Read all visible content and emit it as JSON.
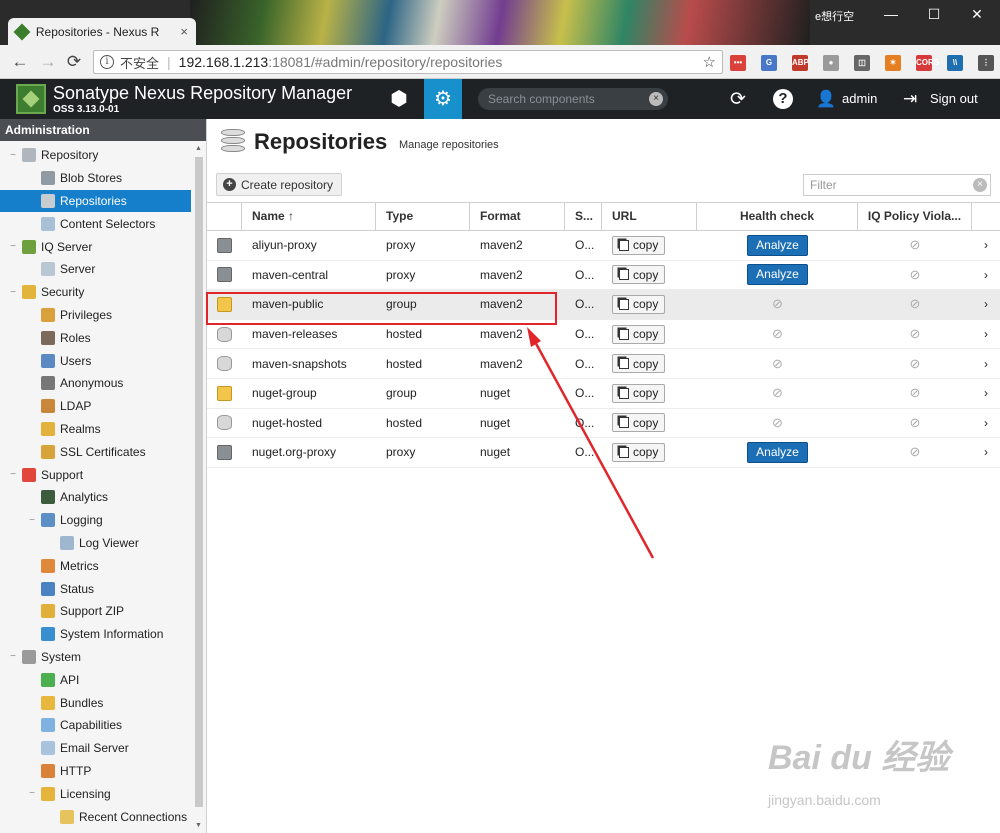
{
  "browser": {
    "tab_title": "Repositories - Nexus R",
    "tab_close": "×",
    "window_user": "e想行空",
    "window_buttons": [
      "—",
      "☐",
      "✕"
    ],
    "nav": {
      "back": "←",
      "forward": "→",
      "reload": "⟳"
    },
    "info_icon": "i",
    "insecure_label": "不安全",
    "separator": "|",
    "url_host": "192.168.1.213",
    "url_path": ":18081/#admin/repository/repositories",
    "bookmark_star": "☆",
    "extensions": [
      {
        "name": "ext-dots",
        "color": "#d9413a",
        "label": "•••"
      },
      {
        "name": "ext-translate",
        "color": "#4a78c8",
        "label": "G"
      },
      {
        "name": "ext-abp",
        "color": "#c0392b",
        "label": "ABP"
      },
      {
        "name": "ext-record",
        "color": "#9a9a9a",
        "label": "●"
      },
      {
        "name": "ext-reader",
        "color": "#666666",
        "label": "◫"
      },
      {
        "name": "ext-orange",
        "color": "#e67e22",
        "label": "✶"
      },
      {
        "name": "ext-cors",
        "color": "#d63a3a",
        "label": "CORS"
      },
      {
        "name": "ext-stripes",
        "color": "#1f6fb0",
        "label": "\\\\"
      },
      {
        "name": "ext-menu",
        "color": "#555555",
        "label": "⋮"
      }
    ]
  },
  "header": {
    "title": "Sonatype Nexus Repository Manager",
    "version": "OSS 3.13.0-01",
    "browse_icon": "⬢",
    "admin_icon": "⚙",
    "search_placeholder": "Search components",
    "search_clear": "×",
    "refresh_icon": "⟳",
    "help_icon": "?",
    "user_icon": "👤",
    "user": "admin",
    "signout_icon": "⇥",
    "signout": "Sign out"
  },
  "sidebar": {
    "title": "Administration",
    "items": [
      {
        "label": "Repository",
        "level": 0,
        "toggle": "−",
        "color": "#b0b6bd"
      },
      {
        "label": "Blob Stores",
        "level": 1,
        "toggle": "",
        "color": "#8f9aa3"
      },
      {
        "label": "Repositories",
        "level": 1,
        "toggle": "",
        "color": "#c7ccd1",
        "selected": true
      },
      {
        "label": "Content Selectors",
        "level": 1,
        "toggle": "",
        "color": "#a8c0d8"
      },
      {
        "label": "IQ Server",
        "level": 0,
        "toggle": "−",
        "color": "#6fa03e"
      },
      {
        "label": "Server",
        "level": 1,
        "toggle": "",
        "color": "#b9c7d4"
      },
      {
        "label": "Security",
        "level": 0,
        "toggle": "−",
        "color": "#e2b43b"
      },
      {
        "label": "Privileges",
        "level": 1,
        "toggle": "",
        "color": "#d9a03b"
      },
      {
        "label": "Roles",
        "level": 1,
        "toggle": "",
        "color": "#7b6a5a"
      },
      {
        "label": "Users",
        "level": 1,
        "toggle": "",
        "color": "#5b89c4"
      },
      {
        "label": "Anonymous",
        "level": 1,
        "toggle": "",
        "color": "#777777"
      },
      {
        "label": "LDAP",
        "level": 1,
        "toggle": "",
        "color": "#c9873a"
      },
      {
        "label": "Realms",
        "level": 1,
        "toggle": "",
        "color": "#e3b23c"
      },
      {
        "label": "SSL Certificates",
        "level": 1,
        "toggle": "",
        "color": "#d6a43b"
      },
      {
        "label": "Support",
        "level": 0,
        "toggle": "−",
        "color": "#e2453c"
      },
      {
        "label": "Analytics",
        "level": 1,
        "toggle": "",
        "color": "#3d5b3d"
      },
      {
        "label": "Logging",
        "level": 1,
        "toggle": "−",
        "color": "#5d8fc7"
      },
      {
        "label": "Log Viewer",
        "level": 2,
        "toggle": "",
        "color": "#9fb6cf"
      },
      {
        "label": "Metrics",
        "level": 1,
        "toggle": "",
        "color": "#e0893a"
      },
      {
        "label": "Status",
        "level": 1,
        "toggle": "",
        "color": "#4b82c2"
      },
      {
        "label": "Support ZIP",
        "level": 1,
        "toggle": "",
        "color": "#e0b03a"
      },
      {
        "label": "System Information",
        "level": 1,
        "toggle": "",
        "color": "#3a8fd0"
      },
      {
        "label": "System",
        "level": 0,
        "toggle": "−",
        "color": "#9a9a9a"
      },
      {
        "label": "API",
        "level": 1,
        "toggle": "",
        "color": "#4caf50"
      },
      {
        "label": "Bundles",
        "level": 1,
        "toggle": "",
        "color": "#e8b83e"
      },
      {
        "label": "Capabilities",
        "level": 1,
        "toggle": "",
        "color": "#7fb2e0"
      },
      {
        "label": "Email Server",
        "level": 1,
        "toggle": "",
        "color": "#a9c3de"
      },
      {
        "label": "HTTP",
        "level": 1,
        "toggle": "",
        "color": "#d9823a"
      },
      {
        "label": "Licensing",
        "level": 1,
        "toggle": "−",
        "color": "#e6b33c"
      },
      {
        "label": "Recent Connections",
        "level": 2,
        "toggle": "",
        "color": "#e6c35c"
      }
    ],
    "scroll_up": "▲",
    "scroll_down": "▼"
  },
  "main": {
    "title": "Repositories",
    "subtitle": "Manage repositories",
    "create_button": "Create repository",
    "create_icon": "+",
    "filter_placeholder": "Filter",
    "filter_clear": "×",
    "columns": [
      "Name ↑",
      "Type",
      "Format",
      "S...",
      "URL",
      "Health check",
      "IQ Policy Viola..."
    ],
    "copy_label": "copy",
    "analyze_label": "Analyze",
    "na_symbol": "⊘",
    "row_chevron": "›",
    "rows": [
      {
        "name": "aliyun-proxy",
        "type": "proxy",
        "format": "maven2",
        "status": "O...",
        "health": "analyze",
        "iq": "⊘"
      },
      {
        "name": "maven-central",
        "type": "proxy",
        "format": "maven2",
        "status": "O...",
        "health": "analyze",
        "iq": "⊘"
      },
      {
        "name": "maven-public",
        "type": "group",
        "format": "maven2",
        "status": "O...",
        "health": "⊘",
        "iq": "⊘",
        "highlighted": true
      },
      {
        "name": "maven-releases",
        "type": "hosted",
        "format": "maven2",
        "status": "O...",
        "health": "⊘",
        "iq": "⊘"
      },
      {
        "name": "maven-snapshots",
        "type": "hosted",
        "format": "maven2",
        "status": "O...",
        "health": "⊘",
        "iq": "⊘"
      },
      {
        "name": "nuget-group",
        "type": "group",
        "format": "nuget",
        "status": "O...",
        "health": "⊘",
        "iq": "⊘"
      },
      {
        "name": "nuget-hosted",
        "type": "hosted",
        "format": "nuget",
        "status": "O...",
        "health": "⊘",
        "iq": "⊘"
      },
      {
        "name": "nuget.org-proxy",
        "type": "proxy",
        "format": "nuget",
        "status": "O...",
        "health": "analyze",
        "iq": "⊘"
      }
    ]
  },
  "annotation": {
    "color": "#e0262b"
  },
  "watermark": {
    "text": "Bai du 经验",
    "sub": "jingyan.baidu.com"
  }
}
